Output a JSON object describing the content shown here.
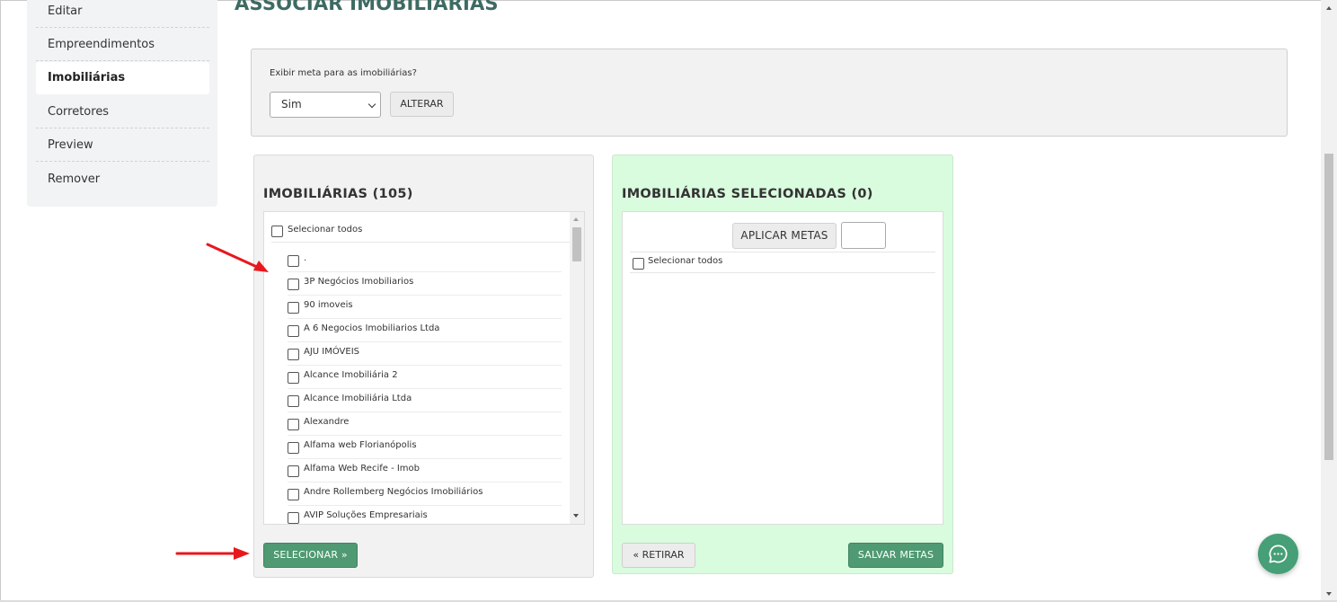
{
  "sidebar": {
    "items": [
      {
        "label": "Editar"
      },
      {
        "label": "Empreendimentos"
      },
      {
        "label": "Imobiliárias",
        "active": true
      },
      {
        "label": "Corretores"
      },
      {
        "label": "Preview"
      },
      {
        "label": "Remover"
      }
    ]
  },
  "page": {
    "title": "ASSOCIAR IMOBILIÁRIAS"
  },
  "meta": {
    "label": "Exibir meta para as imobiliárias?",
    "select_value": "Sim",
    "alter_button": "ALTERAR"
  },
  "left_panel": {
    "title": "IMOBILIÁRIAS (105)",
    "select_all": "Selecionar todos",
    "items": [
      ".",
      "3P Negócios Imobiliarios",
      "90 imoveis",
      "A 6 Negocios Imobiliarios Ltda",
      "AJU IMÓVEIS",
      "Alcance Imobiliária 2",
      "Alcance Imobiliária Ltda",
      "Alexandre",
      "Alfama web Florianópolis",
      "Alfama Web Recife - Imob",
      "Andre Rollemberg Negócios Imobiliários",
      "AVIP Soluções Empresariais"
    ],
    "select_button": "SELECIONAR »"
  },
  "right_panel": {
    "title": "IMOBILIÁRIAS SELECIONADAS (0)",
    "apply_button": "APLICAR METAS",
    "metas_input_value": "",
    "select_all": "Selecionar todos",
    "remove_button": "« RETIRAR",
    "save_button": "SALVAR METAS"
  },
  "icons": {
    "chat": "chat-bubble-icon",
    "arrow_color": "#e8171c"
  },
  "colors": {
    "title": "#3d6b63",
    "primary_button": "#4f9a72",
    "selected_panel_bg": "#d9fbde",
    "chat_fab": "#469f76"
  }
}
